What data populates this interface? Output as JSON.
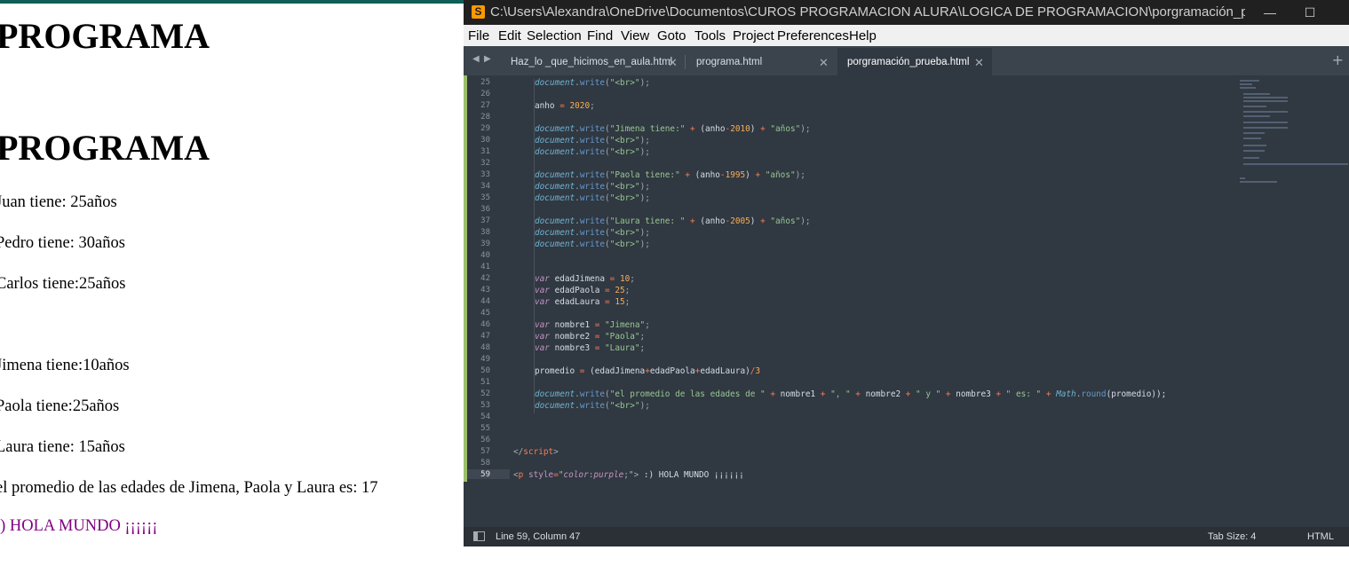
{
  "browser": {
    "headings": [
      "PROGRAMA",
      "PROGRAMA"
    ],
    "lines": [
      "Juan tiene: 25años",
      "Pedro tiene: 30años",
      "Carlos tiene:25años",
      "Jimena tiene:10años",
      "Paola tiene:25años",
      "Laura tiene: 15años",
      "el promedio de las edades de Jimena, Paola y Laura es: 17"
    ],
    "hola": ":) HOLA MUNDO ¡¡¡¡¡¡",
    "hola_color": "#800080"
  },
  "editor": {
    "window_title": "C:\\Users\\Alexandra\\OneDrive\\Documentos\\CUROS PROGRAMACION ALURA\\LOGICA DE PROGRAMACION\\porgramación_prue...",
    "app_icon": "sublime-text-icon",
    "menu": [
      "File",
      "Edit",
      "Selection",
      "Find",
      "View",
      "Goto",
      "Tools",
      "Project",
      "Preferences",
      "Help"
    ],
    "tabs": [
      {
        "label": "Haz_lo _que_hicimos_en_aula.html",
        "active": false
      },
      {
        "label": "programa.html",
        "active": false
      },
      {
        "label": "porgramación_prueba.html",
        "active": true
      }
    ],
    "line_numbers": [
      "25",
      "26",
      "27",
      "28",
      "29",
      "30",
      "31",
      "32",
      "33",
      "34",
      "35",
      "36",
      "37",
      "38",
      "39",
      "40",
      "41",
      "42",
      "43",
      "44",
      "45",
      "46",
      "47",
      "48",
      "49",
      "50",
      "51",
      "52",
      "53",
      "54",
      "55",
      "56",
      "57",
      "58",
      "59"
    ],
    "current_line": "59",
    "code": {
      "l25": [
        "document",
        ".",
        "write",
        "(",
        "\"<br>\"",
        ");"
      ],
      "l27": [
        "anho",
        " = ",
        "2020",
        ";"
      ],
      "l29": [
        "document",
        ".",
        "write",
        "(",
        "\"Jimena tiene:\"",
        " + ",
        "(anho",
        "-",
        "2010",
        ") ",
        "+",
        " ",
        "\"años\"",
        ");"
      ],
      "l30": [
        "document",
        ".",
        "write",
        "(",
        "\"<br>\"",
        ");"
      ],
      "l31": [
        "document",
        ".",
        "write",
        "(",
        "\"<br>\"",
        ");"
      ],
      "l33": [
        "document",
        ".",
        "write",
        "(",
        "\"Paola tiene:\"",
        " + ",
        "(anho",
        "-",
        "1995",
        ") ",
        "+",
        " ",
        "\"años\"",
        ");"
      ],
      "l34": [
        "document",
        ".",
        "write",
        "(",
        "\"<br>\"",
        ");"
      ],
      "l35": [
        "document",
        ".",
        "write",
        "(",
        "\"<br>\"",
        ");"
      ],
      "l37": [
        "document",
        ".",
        "write",
        "(",
        "\"Laura tiene: \"",
        " + ",
        "(anho",
        "-",
        "2005",
        ") ",
        "+",
        " ",
        "\"años\"",
        ");"
      ],
      "l38": [
        "document",
        ".",
        "write",
        "(",
        "\"<br>\"",
        ");"
      ],
      "l39": [
        "document",
        ".",
        "write",
        "(",
        "\"<br>\"",
        ");"
      ],
      "l42": [
        "var",
        " edadJimena",
        " = ",
        "10",
        ";"
      ],
      "l43": [
        "var",
        " edadPaola",
        " = ",
        "25",
        ";"
      ],
      "l44": [
        "var",
        " edadLaura",
        " = ",
        "15",
        ";"
      ],
      "l46": [
        "var",
        " nombre1",
        " = ",
        "\"Jimena\"",
        ";"
      ],
      "l47": [
        "var",
        " nombre2",
        " = ",
        "\"Paola\"",
        ";"
      ],
      "l48": [
        "var",
        " nombre3",
        " = ",
        "\"Laura\"",
        ";"
      ],
      "l50": [
        "promedio",
        " = ",
        "(edadJimena",
        "+",
        "edadPaola",
        "+",
        "edadLaura)",
        "/",
        "3"
      ],
      "l52": [
        "document",
        ".",
        "write",
        "(",
        "\"el promedio de las edades de \"",
        " + ",
        "nombre1",
        " + ",
        "\", \"",
        " + ",
        "nombre2",
        " + ",
        "\" y \"",
        " + ",
        "nombre3",
        " + ",
        "\" es: \"",
        " + ",
        "Math",
        ".",
        "round",
        "(promedio));"
      ],
      "l53": [
        "document",
        ".",
        "write",
        "(",
        "\"<br>\"",
        ");"
      ],
      "l57": [
        "</",
        "script",
        ">"
      ],
      "l59": [
        "<",
        "p",
        " style",
        "=",
        "\"",
        "color",
        ":",
        "purple",
        ";",
        "\"",
        ">",
        " :) HOLA MUNDO ¡¡¡¡¡¡"
      ]
    },
    "status": {
      "position": "Line 59, Column 47",
      "tab_size": "Tab Size: 4",
      "syntax": "HTML"
    },
    "colors": {
      "background": "#303841",
      "tab_bar": "#3b434c",
      "status_bar": "#2b3036",
      "string": "#99c794",
      "number": "#f9ae58",
      "keyword": "#c594c5",
      "function": "#6699cc",
      "operator": "#f97b58"
    }
  }
}
